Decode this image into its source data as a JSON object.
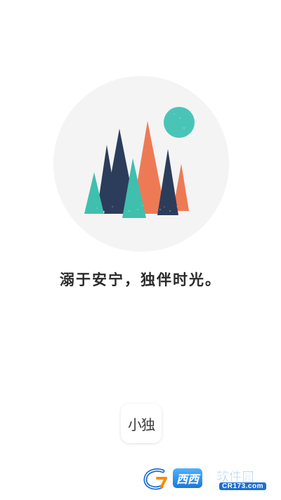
{
  "splash": {
    "tagline": "溺于安宁，独伴时光。",
    "logo_text": "小独"
  },
  "illustration": {
    "description_icon": "mountains-moon-illustration",
    "colors": {
      "circle": "#f4f4f4",
      "moon": "#4bc4b8",
      "orange": "#ee7a55",
      "navy": "#2c3d5b",
      "teal": "#3fbfae"
    }
  },
  "watermark": {
    "brand": "西西",
    "name": "软件园",
    "url": "CR173.com",
    "icon": "cr-logo-icon"
  }
}
